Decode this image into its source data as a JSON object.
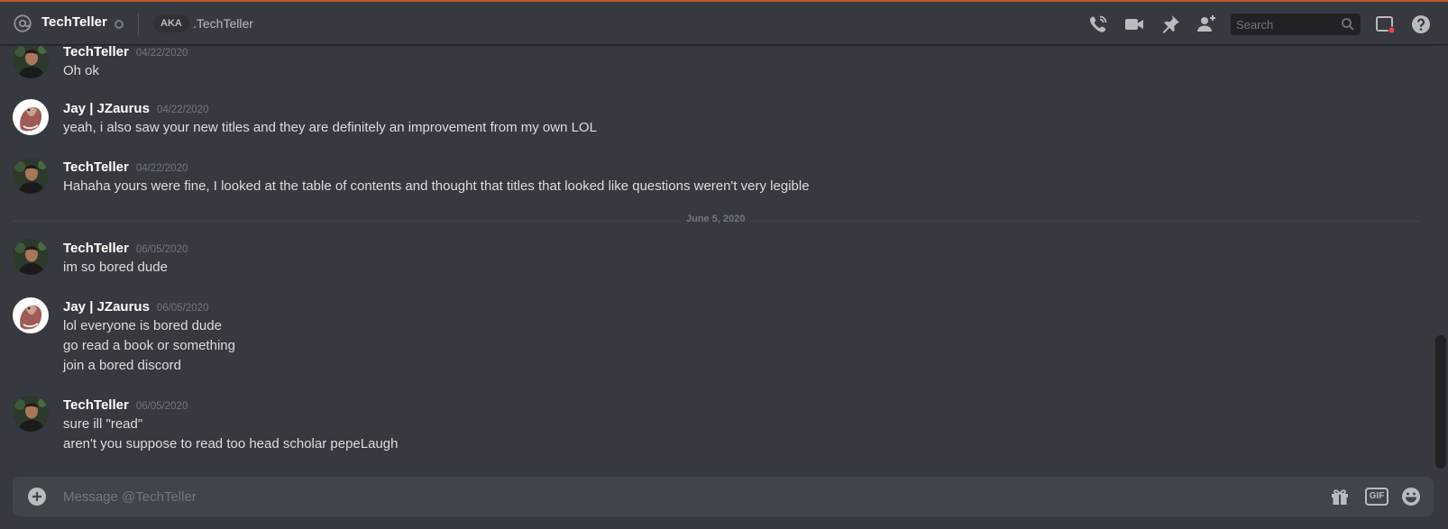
{
  "header": {
    "dm_name": "TechTeller",
    "aka_badge": "AKA",
    "aka_name": ".TechTeller",
    "search_placeholder": "Search",
    "icons": [
      "at-icon",
      "start-voice-call-icon",
      "start-video-call-icon",
      "pinned-messages-icon",
      "add-friend-to-dm-icon",
      "search-icon",
      "inbox-icon",
      "help-icon"
    ]
  },
  "messages": [
    {
      "author": "TechTeller",
      "timestamp": "04/22/2020",
      "avatar": "techteller-avatar",
      "lines": [
        "Oh ok"
      ]
    },
    {
      "author": "Jay | JZaurus",
      "timestamp": "04/22/2020",
      "avatar": "jzaurus-avatar",
      "lines": [
        "yeah, i also saw your new titles and they are definitely an improvement from my own LOL"
      ]
    },
    {
      "author": "TechTeller",
      "timestamp": "04/22/2020",
      "avatar": "techteller-avatar",
      "lines": [
        "Hahaha yours were fine, I looked at the table of contents and thought that titles that looked like questions weren't very legible"
      ]
    },
    {
      "author": "TechTeller",
      "timestamp": "06/05/2020",
      "avatar": "techteller-avatar",
      "lines": [
        "im so bored dude"
      ]
    },
    {
      "author": "Jay | JZaurus",
      "timestamp": "06/05/2020",
      "avatar": "jzaurus-avatar",
      "lines": [
        "lol everyone is bored dude",
        "go read a book or something",
        "join a bored discord"
      ]
    },
    {
      "author": "TechTeller",
      "timestamp": "06/05/2020",
      "avatar": "techteller-avatar",
      "lines": [
        "sure ill \"read\"",
        "aren't you suppose to read too head scholar pepeLaugh"
      ]
    }
  ],
  "date_divider": "June 5, 2020",
  "composer": {
    "placeholder": "Message @TechTeller",
    "gif_label": "GIF",
    "icons": [
      "attach-plus-icon",
      "gift-icon",
      "gif-icon",
      "emoji-icon"
    ]
  },
  "colors": {
    "background": "#36393f",
    "header_accent_line": "#c0552b",
    "status_offline": "#747f8d",
    "inbox_badge": "#ed4245"
  }
}
